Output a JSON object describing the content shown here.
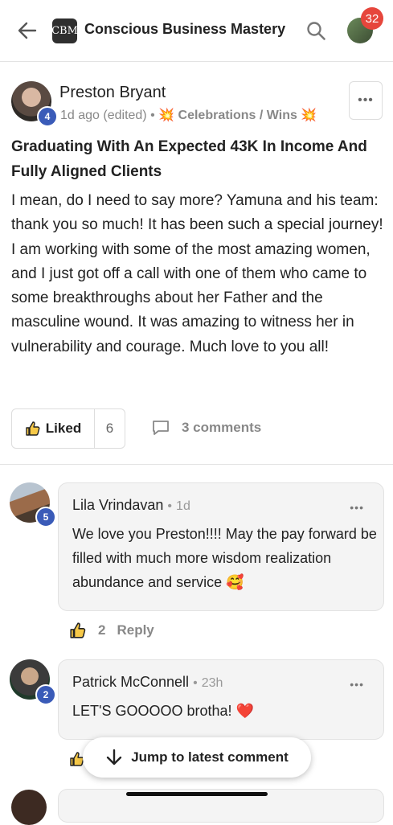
{
  "header": {
    "title": "Conscious Business Mastery",
    "logo_text": "CBM",
    "notification_count": "32"
  },
  "post": {
    "author": "Preston Bryant",
    "level": "4",
    "time": "1d ago (edited)",
    "separator": "•",
    "category": "Celebrations / Wins",
    "category_emoji": "💥",
    "title": "Graduating With An Expected 43K In Income And Fully Aligned Clients",
    "body": "I mean, do I need to say more? Yamuna and his team: thank you so much! It has been such a special journey! I am working with some of the most amazing women, and I just got off a call with one of them who came to some breakthroughs about her Father and the masculine wound. It was amazing to witness her in vulnerability and courage. Much love to you all!",
    "like_label": "Liked",
    "like_count": "6",
    "comments_label": "3 comments"
  },
  "comments": [
    {
      "author": "Lila Vrindavan",
      "level": "5",
      "time": "1d",
      "text": "We love you Preston!!!! May the pay forward be filled with much more wisdom realization abundance and service 🥰",
      "like_count": "2",
      "reply_label": "Reply"
    },
    {
      "author": "Patrick McConnell",
      "level": "2",
      "time": "23h",
      "text": "LET'S GOOOOO brotha! ❤️"
    }
  ],
  "jump_label": "Jump to latest comment",
  "colors": {
    "level_badge": "#3a5bb8",
    "notification": "#e6463c"
  }
}
